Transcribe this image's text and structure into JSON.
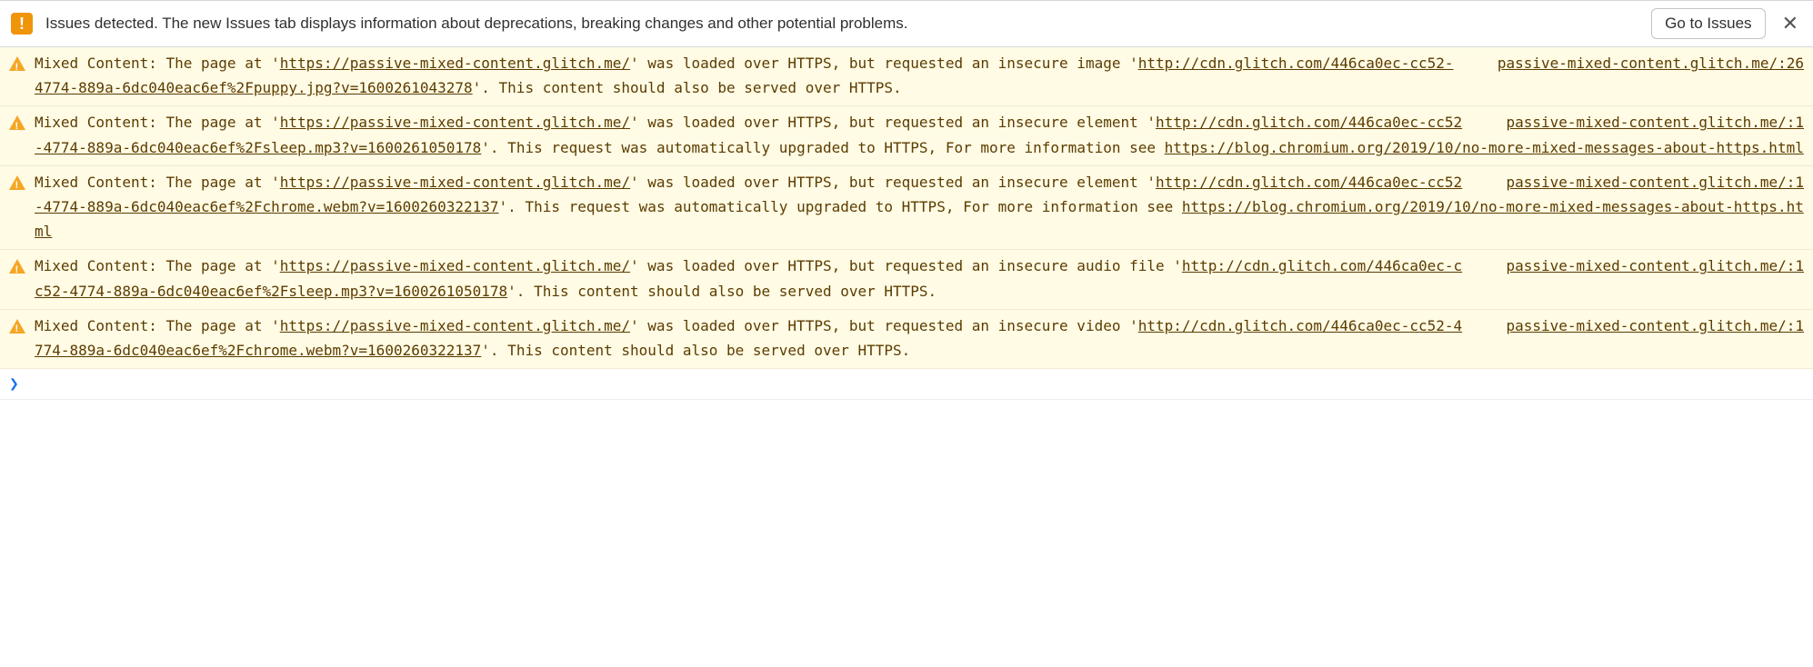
{
  "issuesBar": {
    "iconGlyph": "!",
    "message": "Issues detected. The new Issues tab displays information about deprecations, breaking changes and other potential problems.",
    "buttonLabel": "Go to Issues",
    "closeGlyph": "✕"
  },
  "warnings": [
    {
      "source": "passive-mixed-content.glitch.me/:26",
      "segments": [
        {
          "t": "text",
          "v": "Mixed Content: The page at '"
        },
        {
          "t": "link",
          "v": "https://passive-mixed-content.glitch.me/"
        },
        {
          "t": "text",
          "v": "' was loaded over HTTPS, but requested an insecure image '"
        },
        {
          "t": "link",
          "v": "http://cdn.glitch.com/446ca0ec-cc52-4774-889a-6dc040eac6ef%2Fpuppy.jpg?v=1600261043278"
        },
        {
          "t": "text",
          "v": "'. This content should also be served over HTTPS."
        }
      ]
    },
    {
      "source": "passive-mixed-content.glitch.me/:1",
      "segments": [
        {
          "t": "text",
          "v": "Mixed Content: The page at '"
        },
        {
          "t": "link",
          "v": "https://passive-mixed-content.glitch.me/"
        },
        {
          "t": "text",
          "v": "' was loaded over HTTPS, but requested an insecure element '"
        },
        {
          "t": "link",
          "v": "http://cdn.glitch.com/446ca0ec-cc52-4774-889a-6dc040eac6ef%2Fsleep.mp3?v=1600261050178"
        },
        {
          "t": "text",
          "v": "'. This request was automatically upgraded to HTTPS, For more information see "
        },
        {
          "t": "link",
          "v": "https://blog.chromium.org/2019/10/no-more-mixed-messages-about-https.html"
        }
      ]
    },
    {
      "source": "passive-mixed-content.glitch.me/:1",
      "segments": [
        {
          "t": "text",
          "v": "Mixed Content: The page at '"
        },
        {
          "t": "link",
          "v": "https://passive-mixed-content.glitch.me/"
        },
        {
          "t": "text",
          "v": "' was loaded over HTTPS, but requested an insecure element '"
        },
        {
          "t": "link",
          "v": "http://cdn.glitch.com/446ca0ec-cc52-4774-889a-6dc040eac6ef%2Fchrome.webm?v=1600260322137"
        },
        {
          "t": "text",
          "v": "'. This request was automatically upgraded to HTTPS, For more information see "
        },
        {
          "t": "link",
          "v": "https://blog.chromium.org/2019/10/no-more-mixed-messages-about-https.html"
        }
      ]
    },
    {
      "source": "passive-mixed-content.glitch.me/:1",
      "segments": [
        {
          "t": "text",
          "v": "Mixed Content: The page at '"
        },
        {
          "t": "link",
          "v": "https://passive-mixed-content.glitch.me/"
        },
        {
          "t": "text",
          "v": "' was loaded over HTTPS, but requested an insecure audio file '"
        },
        {
          "t": "link",
          "v": "http://cdn.glitch.com/446ca0ec-cc52-4774-889a-6dc040eac6ef%2Fsleep.mp3?v=1600261050178"
        },
        {
          "t": "text",
          "v": "'. This content should also be served over HTTPS."
        }
      ]
    },
    {
      "source": "passive-mixed-content.glitch.me/:1",
      "segments": [
        {
          "t": "text",
          "v": "Mixed Content: The page at '"
        },
        {
          "t": "link",
          "v": "https://passive-mixed-content.glitch.me/"
        },
        {
          "t": "text",
          "v": "' was loaded over HTTPS, but requested an insecure video '"
        },
        {
          "t": "link",
          "v": "http://cdn.glitch.com/446ca0ec-cc52-4774-889a-6dc040eac6ef%2Fchrome.webm?v=1600260322137"
        },
        {
          "t": "text",
          "v": "'. This content should also be served over HTTPS."
        }
      ]
    }
  ],
  "prompt": {
    "glyph": "❯"
  }
}
